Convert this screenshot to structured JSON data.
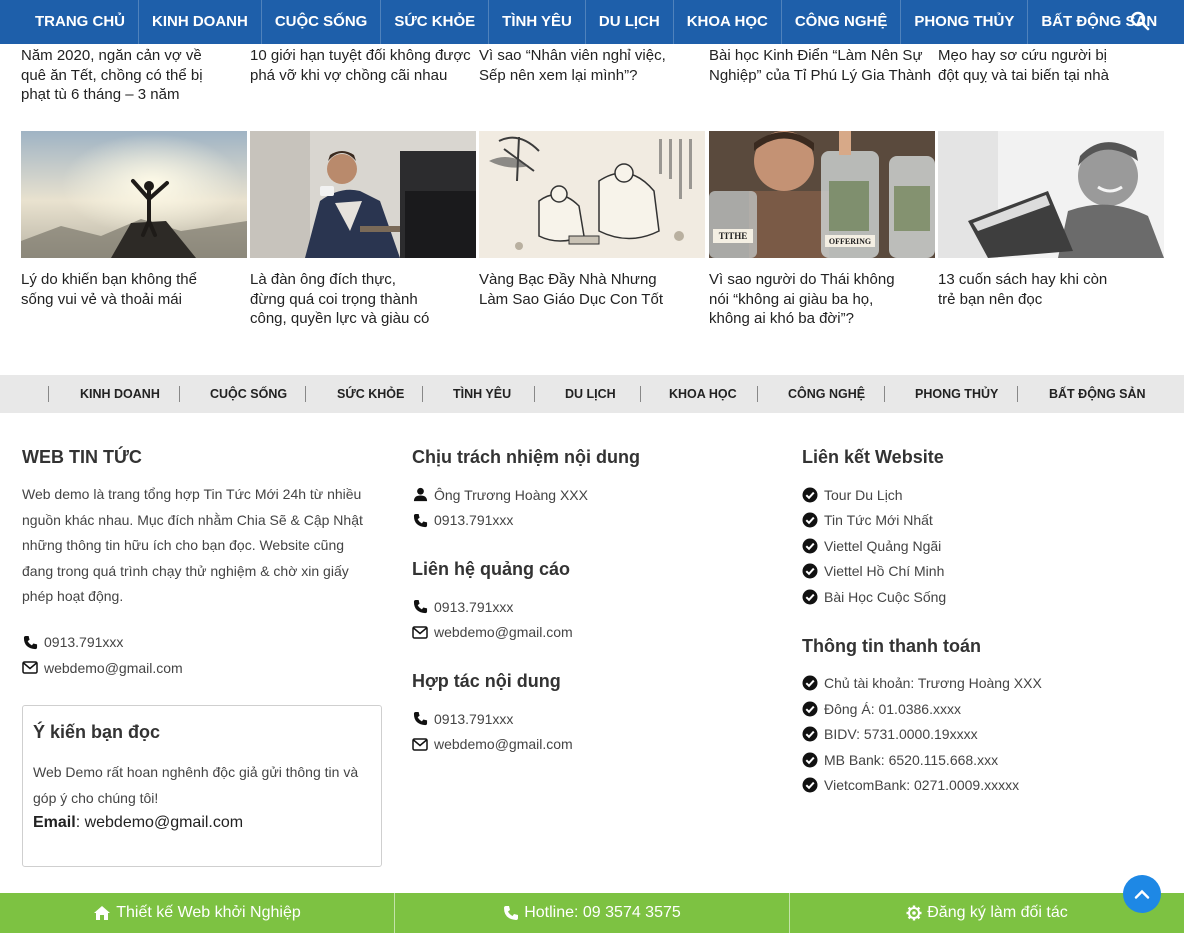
{
  "topnav": {
    "items": [
      "TRANG CHỦ",
      "KINH DOANH",
      "CUỘC SỐNG",
      "SỨC KHỎE",
      "TÌNH YÊU",
      "DU LỊCH",
      "KHOA HỌC",
      "CÔNG NGHỆ",
      "PHONG THỦY",
      "BẤT ĐỘNG SẢN"
    ],
    "search_icon": "search-icon"
  },
  "top_articles": [
    "Năm 2020, ngăn cản vợ về quê ăn Tết, chồng có thể bị phạt tù 6 tháng – 3 năm",
    "10 giới hạn tuyệt đối không được phá vỡ khi vợ chồng cãi nhau",
    "Vì sao “Nhân viên nghỉ việc, Sếp nên xem lại mình”?",
    "Bài học Kinh Điển “Làm Nên Sự Nghiệp” của Tỉ Phú Lý Gia Thành",
    "Mẹo hay sơ cứu người bị đột quỵ và tai biến tại nhà"
  ],
  "image_articles": [
    "Lý do khiến bạn không thể sống vui vẻ và thoải mái",
    "Là đàn ông đích thực, đừng quá coi trọng thành công, quyền lực và giàu có",
    "Vàng Bạc Đầy Nhà Nhưng Làm Sao Giáo Dục Con Tốt",
    "Vì sao người do Thái không nói “không ai giàu ba họ, không ai khó ba đời”?",
    "13 cuốn sách hay khi còn trẻ bạn nên đọc"
  ],
  "jar_labels": [
    "TITHE",
    "OFFERING"
  ],
  "categories": [
    "KINH DOANH",
    "CUỘC SỐNG",
    "SỨC KHỎE",
    "TÌNH YÊU",
    "DU LỊCH",
    "KHOA HỌC",
    "CÔNG NGHỆ",
    "PHONG THỦY",
    "BẤT ĐỘNG SẢN"
  ],
  "footer": {
    "about": {
      "title": "WEB TIN TỨC",
      "description": "Web demo là trang tổng hợp Tin Tức Mới 24h từ nhiều nguồn khác nhau. Mục đích nhằm Chia Sẽ & Cập Nhật những thông tin hữu ích cho bạn đọc. Website cũng đang trong quá trình chạy thử nghiệm & chờ xin giấy phép hoạt động.",
      "phone": "0913.791xxx",
      "email": "webdemo@gmail.com"
    },
    "feedback": {
      "title": "Ý kiến bạn đọc",
      "text": "Web Demo rất hoan nghênh độc giả gửi thông tin và góp ý cho chúng tôi!",
      "email_label": "Email",
      "email": "webdemo@gmail.com"
    },
    "responsible": {
      "title": "Chịu trách nhiệm nội dung",
      "person": "Ông Trương Hoàng XXX",
      "phone": "0913.791xxx"
    },
    "ads": {
      "title": "Liên hệ quảng cáo",
      "phone": "0913.791xxx",
      "email": "webdemo@gmail.com"
    },
    "cooperation": {
      "title": "Hợp tác nội dung",
      "phone": "0913.791xxx",
      "email": "webdemo@gmail.com"
    },
    "links": {
      "title": "Liên kết Website",
      "items": [
        "Tour Du Lịch",
        "Tin Tức Mới Nhất",
        "Viettel Quảng Ngãi",
        "Viettel Hồ Chí Minh",
        "Bài Học Cuộc Sống"
      ]
    },
    "payment": {
      "title": "Thông tin thanh toán",
      "items": [
        "Chủ tài khoản: Trương Hoàng XXX",
        "Đông Á: 01.0386.xxxx",
        "BIDV: 5731.0000.19xxxx",
        "MB Bank: 6520.115.668.xxx",
        "VietcomBank: 0271.0009.xxxxx"
      ]
    }
  },
  "bottombar": {
    "design": "Thiết kế Web khởi Nghiệp",
    "hotline": "Hotline: 09 3574 3575",
    "partner": "Đăng ký làm đối tác"
  },
  "colors": {
    "nav_bg": "#1e5faa",
    "bottom_bar": "#7dc242",
    "to_top": "#1e88e5",
    "category_bar": "#e8e8e8"
  }
}
